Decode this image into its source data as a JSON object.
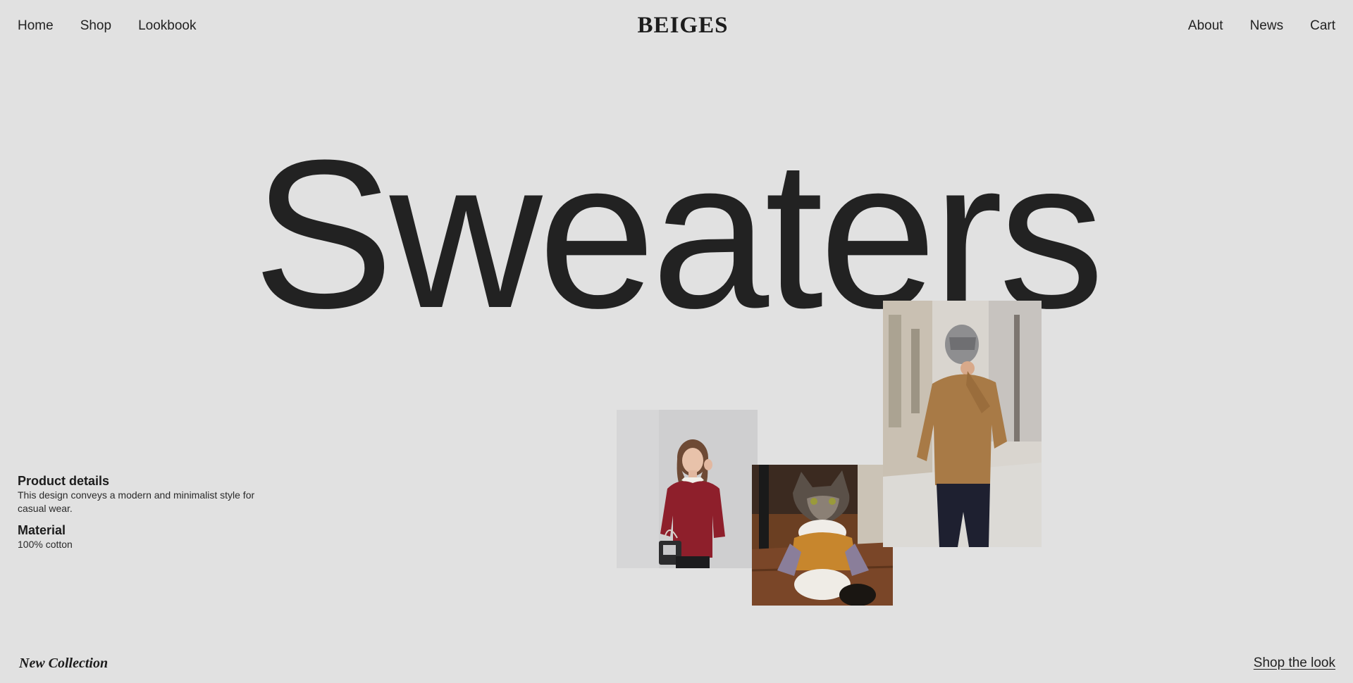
{
  "nav": {
    "left": [
      "Home",
      "Shop",
      "Lookbook"
    ],
    "right": [
      "About",
      "News",
      "Cart"
    ]
  },
  "brand": {
    "logo": "BEIGES"
  },
  "hero": {
    "title": "Sweaters"
  },
  "details": {
    "product_heading": "Product details",
    "product_text": "This design conveys a modern and minimalist style for casual wear.",
    "material_heading": "Material",
    "material_text": "100% cotton"
  },
  "footer": {
    "collection_label": "New Collection",
    "shop_link": "Shop the look"
  },
  "colors": {
    "background": "#e1e1e1",
    "text": "#222222"
  }
}
